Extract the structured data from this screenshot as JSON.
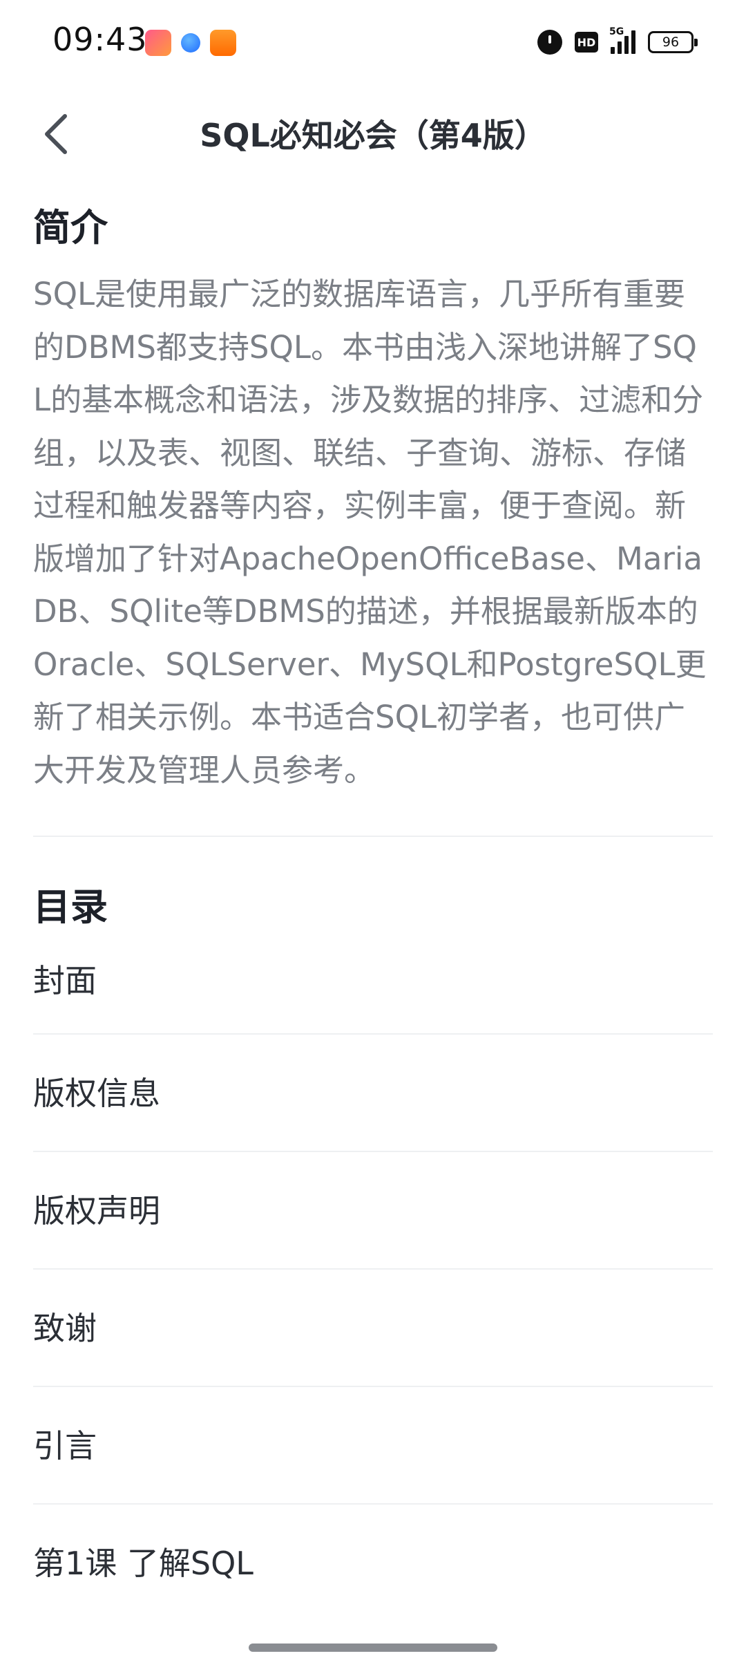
{
  "status_bar": {
    "time": "09:43",
    "app_icons": [
      "pink-app-icon",
      "blue-app-icon",
      "orange-app-icon"
    ],
    "network": "5G",
    "hd_label": "HD",
    "battery": "96"
  },
  "header": {
    "title": "SQL必知必会（第4版）",
    "back_icon": "chevron-left-icon"
  },
  "intro": {
    "heading": "简介",
    "text": "SQL是使用最广泛的数据库语言，几乎所有重要的DBMS都支持SQL。本书由浅入深地讲解了SQL的基本概念和语法，涉及数据的排序、过滤和分组，以及表、视图、联结、子查询、游标、存储过程和触发器等内容，实例丰富，便于查阅。新版增加了针对ApacheOpenOfficeBase、MariaDB、SQlite等DBMS的描述，并根据最新版本的Oracle、SQLServer、MySQL和PostgreSQL更新了相关示例。本书适合SQL初学者，也可供广大开发及管理人员参考。"
  },
  "toc": {
    "heading": "目录",
    "items": [
      {
        "label": "封面"
      },
      {
        "label": "版权信息"
      },
      {
        "label": "版权声明"
      },
      {
        "label": "致谢"
      },
      {
        "label": "引言"
      },
      {
        "label": "第1课 了解SQL"
      }
    ]
  },
  "colors": {
    "text_primary": "#1d2129",
    "text_secondary": "#7b7f86",
    "divider": "#eef0f2"
  }
}
